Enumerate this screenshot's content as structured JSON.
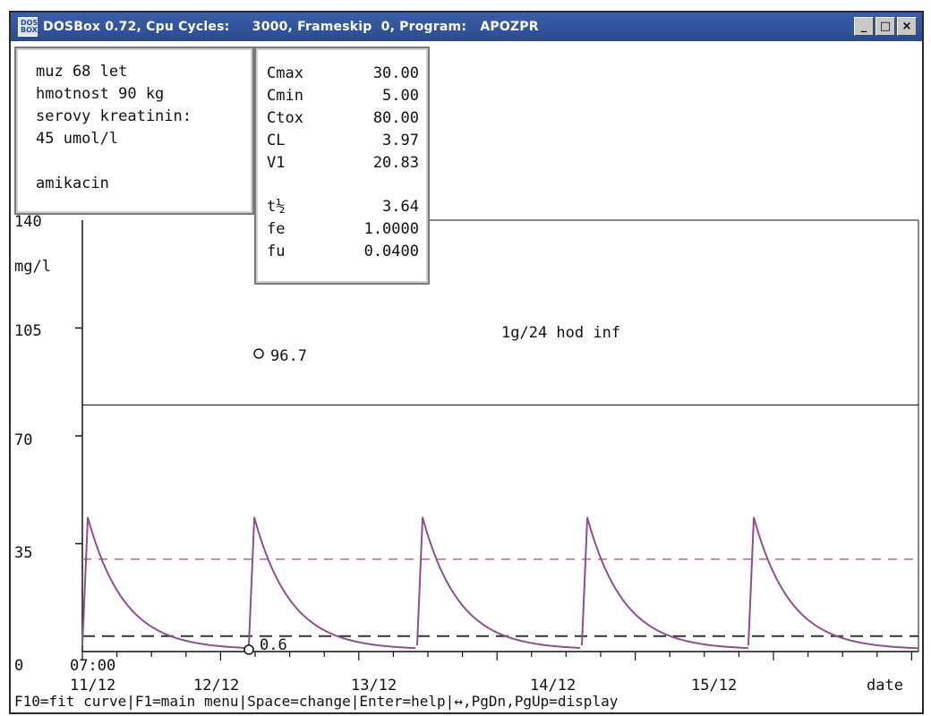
{
  "window": {
    "title": "DOSBox 0.72, Cpu Cycles:     3000, Frameskip  0, Program:   APOZPR",
    "buttons": [
      "_",
      "□",
      "×"
    ]
  },
  "patient": {
    "lines": [
      "muz 68 let",
      "hmotnost 90 kg",
      "serovy kreatinin:",
      "45 umol/l",
      "",
      "amikacin"
    ]
  },
  "params": [
    {
      "name": "Cmax",
      "value": "30.00"
    },
    {
      "name": "Cmin",
      "value": "5.00"
    },
    {
      "name": "Ctox",
      "value": "80.00"
    },
    {
      "name": "CL",
      "value": "3.97"
    },
    {
      "name": "V1",
      "value": "20.83"
    },
    {
      "name": "t½",
      "value": "3.64"
    },
    {
      "name": "fe",
      "value": "1.0000"
    },
    {
      "name": "fu",
      "value": "0.0400"
    }
  ],
  "chart": {
    "unit": "mg/l",
    "y_top_label": "140",
    "y_ticks": [
      "105",
      "70",
      "35",
      "0"
    ],
    "start_time": "07:00",
    "dates": [
      "11/12",
      "12/12",
      "13/12",
      "14/12",
      "15/12"
    ],
    "x_axis_label": "date",
    "regimen": "1g/24 hod inf",
    "peak_point_label": "96.7",
    "trough_point_label": "0.6",
    "curve_color": "#8e4f8f"
  },
  "chart_data": {
    "type": "line",
    "title": "1g/24 hod inf",
    "ylabel": "mg/l",
    "xlabel": "date",
    "ylim": [
      0,
      140
    ],
    "x_categories": [
      "11/12",
      "12/12",
      "13/12",
      "14/12",
      "15/12"
    ],
    "series": [
      {
        "name": "amikacin",
        "doses_count": 5,
        "peak": 43,
        "trough": 0.6,
        "half_life_h": 3.64,
        "interval_h": 24
      }
    ],
    "reference_lines": {
      "Cmax": 30,
      "Cmin": 5,
      "Ctox": 80
    },
    "measured_points": [
      {
        "day": "12/12",
        "value": 96.7
      },
      {
        "day": "12/12",
        "value": 0.6
      }
    ]
  },
  "status_bar": [
    "F10=fit curve",
    "F1=main menu",
    "Space=change",
    "Enter=help",
    "↔,PgDn,PgUp=display"
  ]
}
